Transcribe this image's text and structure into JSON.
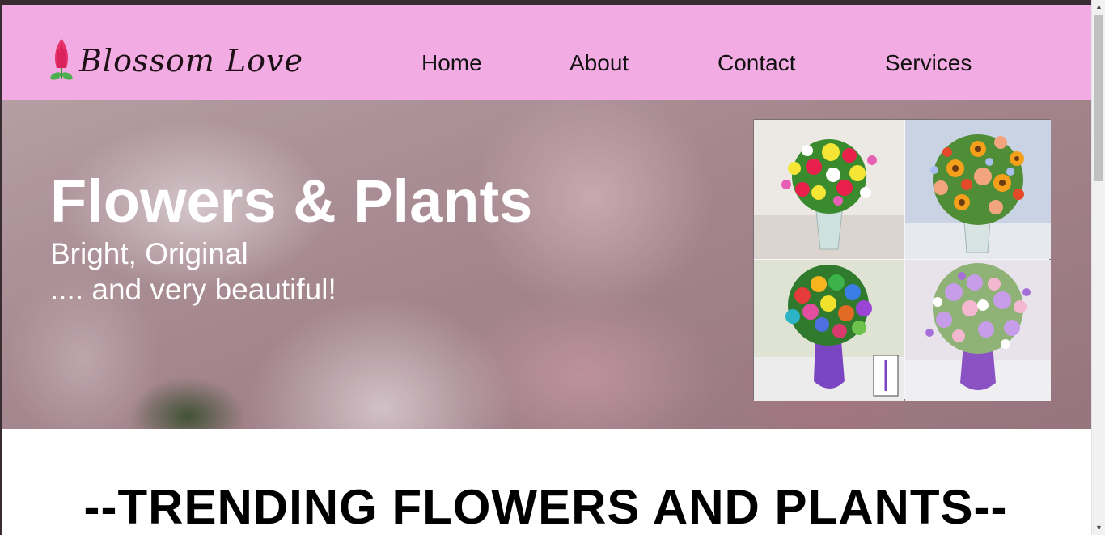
{
  "brand": {
    "name": "Blossom Love",
    "icon": "tulip-icon"
  },
  "nav": [
    {
      "label": "Home"
    },
    {
      "label": "About"
    },
    {
      "label": "Contact"
    },
    {
      "label": "Services"
    }
  ],
  "hero": {
    "title": "Flowers & Plants",
    "subtitle_line1": "Bright, Original",
    "subtitle_line2": ".... and very beautiful!"
  },
  "gallery": [
    {
      "name": "lily-rose-bouquet"
    },
    {
      "name": "sunflower-bouquet"
    },
    {
      "name": "rainbow-rose-bouquet"
    },
    {
      "name": "lavender-bouquet"
    }
  ],
  "section": {
    "title": "--TRENDING FLOWERS AND PLANTS--"
  },
  "colors": {
    "header_bg": "#f3abe3",
    "brand_tulip": "#e6336b",
    "text": "#111111"
  }
}
